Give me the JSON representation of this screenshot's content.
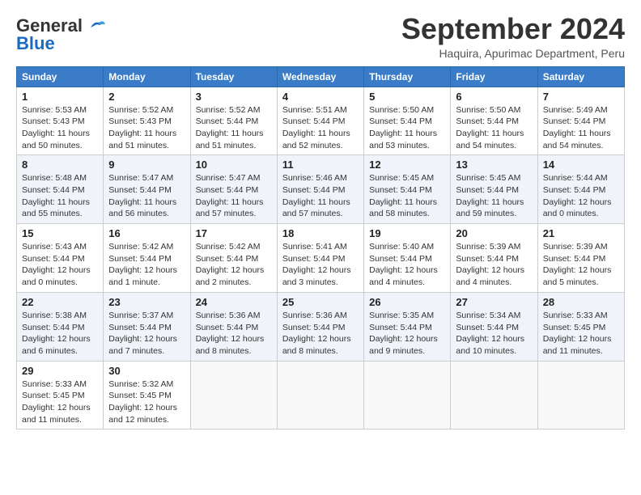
{
  "header": {
    "logo_line1": "General",
    "logo_line2": "Blue",
    "month": "September 2024",
    "location": "Haquira, Apurimac Department, Peru"
  },
  "weekdays": [
    "Sunday",
    "Monday",
    "Tuesday",
    "Wednesday",
    "Thursday",
    "Friday",
    "Saturday"
  ],
  "weeks": [
    [
      {
        "day": "1",
        "info": "Sunrise: 5:53 AM\nSunset: 5:43 PM\nDaylight: 11 hours\nand 50 minutes."
      },
      {
        "day": "2",
        "info": "Sunrise: 5:52 AM\nSunset: 5:43 PM\nDaylight: 11 hours\nand 51 minutes."
      },
      {
        "day": "3",
        "info": "Sunrise: 5:52 AM\nSunset: 5:44 PM\nDaylight: 11 hours\nand 51 minutes."
      },
      {
        "day": "4",
        "info": "Sunrise: 5:51 AM\nSunset: 5:44 PM\nDaylight: 11 hours\nand 52 minutes."
      },
      {
        "day": "5",
        "info": "Sunrise: 5:50 AM\nSunset: 5:44 PM\nDaylight: 11 hours\nand 53 minutes."
      },
      {
        "day": "6",
        "info": "Sunrise: 5:50 AM\nSunset: 5:44 PM\nDaylight: 11 hours\nand 54 minutes."
      },
      {
        "day": "7",
        "info": "Sunrise: 5:49 AM\nSunset: 5:44 PM\nDaylight: 11 hours\nand 54 minutes."
      }
    ],
    [
      {
        "day": "8",
        "info": "Sunrise: 5:48 AM\nSunset: 5:44 PM\nDaylight: 11 hours\nand 55 minutes."
      },
      {
        "day": "9",
        "info": "Sunrise: 5:47 AM\nSunset: 5:44 PM\nDaylight: 11 hours\nand 56 minutes."
      },
      {
        "day": "10",
        "info": "Sunrise: 5:47 AM\nSunset: 5:44 PM\nDaylight: 11 hours\nand 57 minutes."
      },
      {
        "day": "11",
        "info": "Sunrise: 5:46 AM\nSunset: 5:44 PM\nDaylight: 11 hours\nand 57 minutes."
      },
      {
        "day": "12",
        "info": "Sunrise: 5:45 AM\nSunset: 5:44 PM\nDaylight: 11 hours\nand 58 minutes."
      },
      {
        "day": "13",
        "info": "Sunrise: 5:45 AM\nSunset: 5:44 PM\nDaylight: 11 hours\nand 59 minutes."
      },
      {
        "day": "14",
        "info": "Sunrise: 5:44 AM\nSunset: 5:44 PM\nDaylight: 12 hours\nand 0 minutes."
      }
    ],
    [
      {
        "day": "15",
        "info": "Sunrise: 5:43 AM\nSunset: 5:44 PM\nDaylight: 12 hours\nand 0 minutes."
      },
      {
        "day": "16",
        "info": "Sunrise: 5:42 AM\nSunset: 5:44 PM\nDaylight: 12 hours\nand 1 minute."
      },
      {
        "day": "17",
        "info": "Sunrise: 5:42 AM\nSunset: 5:44 PM\nDaylight: 12 hours\nand 2 minutes."
      },
      {
        "day": "18",
        "info": "Sunrise: 5:41 AM\nSunset: 5:44 PM\nDaylight: 12 hours\nand 3 minutes."
      },
      {
        "day": "19",
        "info": "Sunrise: 5:40 AM\nSunset: 5:44 PM\nDaylight: 12 hours\nand 4 minutes."
      },
      {
        "day": "20",
        "info": "Sunrise: 5:39 AM\nSunset: 5:44 PM\nDaylight: 12 hours\nand 4 minutes."
      },
      {
        "day": "21",
        "info": "Sunrise: 5:39 AM\nSunset: 5:44 PM\nDaylight: 12 hours\nand 5 minutes."
      }
    ],
    [
      {
        "day": "22",
        "info": "Sunrise: 5:38 AM\nSunset: 5:44 PM\nDaylight: 12 hours\nand 6 minutes."
      },
      {
        "day": "23",
        "info": "Sunrise: 5:37 AM\nSunset: 5:44 PM\nDaylight: 12 hours\nand 7 minutes."
      },
      {
        "day": "24",
        "info": "Sunrise: 5:36 AM\nSunset: 5:44 PM\nDaylight: 12 hours\nand 8 minutes."
      },
      {
        "day": "25",
        "info": "Sunrise: 5:36 AM\nSunset: 5:44 PM\nDaylight: 12 hours\nand 8 minutes."
      },
      {
        "day": "26",
        "info": "Sunrise: 5:35 AM\nSunset: 5:44 PM\nDaylight: 12 hours\nand 9 minutes."
      },
      {
        "day": "27",
        "info": "Sunrise: 5:34 AM\nSunset: 5:44 PM\nDaylight: 12 hours\nand 10 minutes."
      },
      {
        "day": "28",
        "info": "Sunrise: 5:33 AM\nSunset: 5:45 PM\nDaylight: 12 hours\nand 11 minutes."
      }
    ],
    [
      {
        "day": "29",
        "info": "Sunrise: 5:33 AM\nSunset: 5:45 PM\nDaylight: 12 hours\nand 11 minutes."
      },
      {
        "day": "30",
        "info": "Sunrise: 5:32 AM\nSunset: 5:45 PM\nDaylight: 12 hours\nand 12 minutes."
      },
      {
        "day": "",
        "info": ""
      },
      {
        "day": "",
        "info": ""
      },
      {
        "day": "",
        "info": ""
      },
      {
        "day": "",
        "info": ""
      },
      {
        "day": "",
        "info": ""
      }
    ]
  ]
}
